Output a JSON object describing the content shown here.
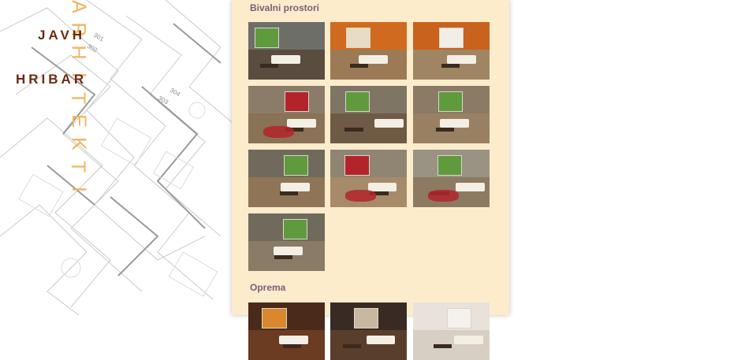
{
  "logo": {
    "line1": "JAVH",
    "line2": "HRIBAR",
    "vertical": "ARHITEKTI"
  },
  "sections": [
    {
      "title": "Bivalni prostori"
    },
    {
      "title": "Oprema"
    }
  ],
  "thumbnails": [
    {
      "name": "living-room-image-1",
      "wall": "#6e6e68",
      "floor": "#5a4c3e",
      "accent": "#5f9a3c"
    },
    {
      "name": "living-room-image-2",
      "wall": "#d06a1e",
      "floor": "#9b7a55",
      "accent": "#e8dcc4"
    },
    {
      "name": "living-room-image-3",
      "wall": "#c9621c",
      "floor": "#a08563",
      "accent": "#f0eee6"
    },
    {
      "name": "living-room-image-4",
      "wall": "#8b7c6a",
      "floor": "#8a7256",
      "accent": "#b3242a"
    },
    {
      "name": "living-room-image-5",
      "wall": "#7f7565",
      "floor": "#6f5a45",
      "accent": "#5f9a3c"
    },
    {
      "name": "living-room-image-6",
      "wall": "#8a7a66",
      "floor": "#9a8063",
      "accent": "#5f9a3c"
    },
    {
      "name": "living-room-image-7",
      "wall": "#6f6a5c",
      "floor": "#8f7458",
      "accent": "#5f9a3c"
    },
    {
      "name": "living-room-image-8",
      "wall": "#8f8572",
      "floor": "#a68a6a",
      "accent": "#b3242a"
    },
    {
      "name": "living-room-image-9",
      "wall": "#9a9282",
      "floor": "#8c7a62",
      "accent": "#5f9a3c"
    },
    {
      "name": "living-room-image-10",
      "wall": "#6f6a5c",
      "floor": "#8a7b66",
      "accent": "#5f9a3c"
    },
    {
      "name": "equipment-image-1",
      "wall": "#4a2a1a",
      "floor": "#6b3b22",
      "accent": "#d9882e"
    },
    {
      "name": "equipment-image-2",
      "wall": "#3a2a24",
      "floor": "#5a3e2c",
      "accent": "#c9b8a0"
    },
    {
      "name": "equipment-image-3",
      "wall": "#e8e2da",
      "floor": "#d8cfc4",
      "accent": "#f5f2ee"
    }
  ]
}
